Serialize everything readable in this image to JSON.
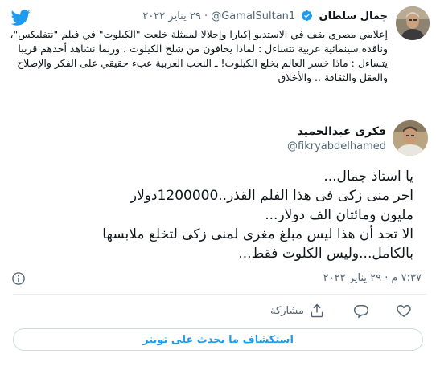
{
  "quoted_tweet": {
    "author_name": "جمال سلطان",
    "handle": "@GamalSultan1",
    "separator": "·",
    "date": "٢٩ يناير ٢٠٢٢",
    "text": "إعلامي مصري يقف في الاستديو إكبارا وإجلالا لممثلة خلعت \"الكيلوت\" في فيلم \"نتفليكس\"، وناقدة سينمائية عربية تتساءل : لماذا يخافون من شلح الكيلوت ، وربما نشاهد أحدهم قريبا يتساءل : ماذا خسر العالم بخلع الكيلوت! ـ النخب العربية عبء حقيقي على الفكر والإصلاح والعقل والثقافة .. والأخلاق"
  },
  "main_tweet": {
    "author_name": "فكرى عبدالحميد",
    "handle": "@fikryabdelhamed",
    "text_lines": [
      "يا استاذ جمال...",
      "اجر منى زكى فى هذا الفلم القذر..1200000دولار",
      "مليون ومائتان الف دولار...",
      "الا تجد أن هذا ليس مبلغ مغرى لمنى زكى لتخلع ملابسها",
      "بالكامل...وليس الكلوت فقط..."
    ],
    "timestamp": "٧:٣٧ م · ٢٩ يناير ٢٠٢٢"
  },
  "actions": {
    "share_label": "مشاركة"
  },
  "cta": {
    "label": "استكشاف ما يحدث على تويتر"
  },
  "colors": {
    "accent": "#1d9bf0",
    "muted": "#536471",
    "text": "#0f1419",
    "border": "#cfd9de"
  },
  "icons": [
    "twitter-bird-icon",
    "verified-badge-icon",
    "info-icon",
    "like-icon",
    "reply-icon",
    "share-icon"
  ]
}
